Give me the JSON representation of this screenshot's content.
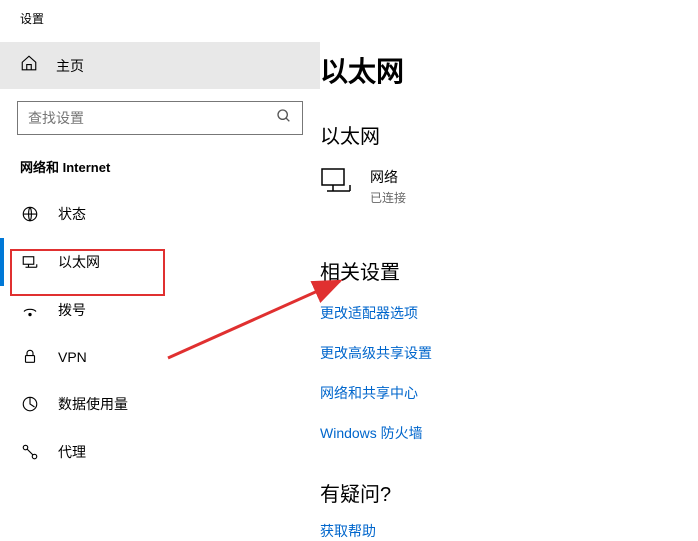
{
  "window_title": "设置",
  "home": {
    "label": "主页"
  },
  "search": {
    "placeholder": "查找设置"
  },
  "category": "网络和 Internet",
  "nav": [
    {
      "label": "状态"
    },
    {
      "label": "以太网"
    },
    {
      "label": "拨号"
    },
    {
      "label": "VPN"
    },
    {
      "label": "数据使用量"
    },
    {
      "label": "代理"
    }
  ],
  "main": {
    "title": "以太网",
    "section": "以太网",
    "network": {
      "name": "网络",
      "status": "已连接"
    },
    "related_title": "相关设置",
    "links": [
      "更改适配器选项",
      "更改高级共享设置",
      "网络和共享中心",
      "Windows 防火墙"
    ],
    "question_title": "有疑问?",
    "help_link": "获取帮助"
  }
}
